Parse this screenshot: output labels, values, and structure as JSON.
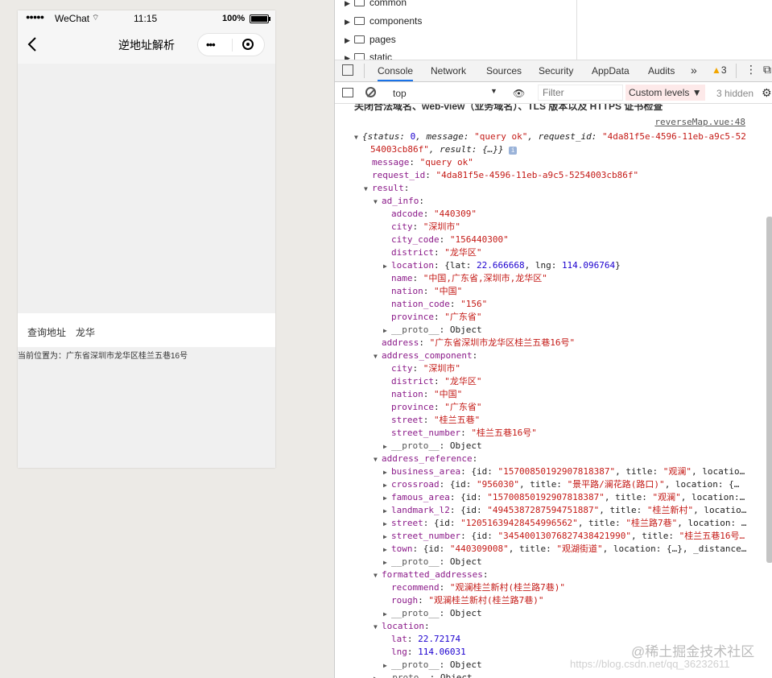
{
  "phone": {
    "status": {
      "signal": "●●●●●",
      "carrier": "WeChat",
      "wifi": "⌔",
      "time": "11:15",
      "battery": "100%"
    },
    "nav": {
      "title": "逆地址解析",
      "menu": "•••"
    },
    "query": {
      "label": "查询地址",
      "value": "龙华"
    },
    "current": "当前位置为：广东省深圳市龙华区桂兰五巷16号"
  },
  "devtools": {
    "tree": [
      {
        "label": "common"
      },
      {
        "label": "components"
      },
      {
        "label": "pages"
      },
      {
        "label": "static"
      }
    ],
    "tabs": [
      "Console",
      "Network",
      "Sources",
      "Security",
      "AppData",
      "Audits"
    ],
    "more": "»",
    "warnings": "3",
    "context": "top",
    "filter_placeholder": "Filter",
    "levels": "Custom levels ▼",
    "hidden": "3 hidden",
    "warning_text": "关闭合法域名、web-view（业务域名）、TLS 版本以及 HTTPS 证书检查",
    "source": "reverseMap.vue:48",
    "lines": [
      {
        "ind": 0,
        "tri": "▼",
        "html": "<span class='i'>{status: </span><span class='n'>0</span><span class='i'>, message: </span><span class='s'>\"query ok\"</span><span class='i'>, request_id: </span><span class='s'>\"4da81f5e-4596-11eb-a9c5-52</span>"
      },
      {
        "ind": 0,
        "tri": "",
        "html": "<span class='s'>54003cb86f\"</span><span class='i'>, result: {…}} </span><span class='info-badge'>i</span>"
      },
      {
        "ind": 1,
        "tri": "",
        "html": "<span class='k'>message</span><span class='p'>: </span><span class='s'>\"query ok\"</span>"
      },
      {
        "ind": 1,
        "tri": "",
        "html": "<span class='k'>request_id</span><span class='p'>: </span><span class='s'>\"4da81f5e-4596-11eb-a9c5-5254003cb86f\"</span>"
      },
      {
        "ind": 1,
        "tri": "▼",
        "html": "<span class='k'>result</span><span class='p'>:</span>"
      },
      {
        "ind": 2,
        "tri": "▼",
        "html": "<span class='k'>ad_info</span><span class='p'>:</span>"
      },
      {
        "ind": 3,
        "tri": "",
        "html": "<span class='k'>adcode</span><span class='p'>: </span><span class='s'>\"440309\"</span>"
      },
      {
        "ind": 3,
        "tri": "",
        "html": "<span class='k'>city</span><span class='p'>: </span><span class='s'>\"深圳市\"</span>"
      },
      {
        "ind": 3,
        "tri": "",
        "html": "<span class='k'>city_code</span><span class='p'>: </span><span class='s'>\"156440300\"</span>"
      },
      {
        "ind": 3,
        "tri": "",
        "html": "<span class='k'>district</span><span class='p'>: </span><span class='s'>\"龙华区\"</span>"
      },
      {
        "ind": 3,
        "tri": "▶",
        "html": "<span class='k'>location</span><span class='p'>: {lat: </span><span class='n'>22.666668</span><span class='p'>, lng: </span><span class='n'>114.096764</span><span class='p'>}</span>"
      },
      {
        "ind": 3,
        "tri": "",
        "html": "<span class='k'>name</span><span class='p'>: </span><span class='s'>\"中国,广东省,深圳市,龙华区\"</span>"
      },
      {
        "ind": 3,
        "tri": "",
        "html": "<span class='k'>nation</span><span class='p'>: </span><span class='s'>\"中国\"</span>"
      },
      {
        "ind": 3,
        "tri": "",
        "html": "<span class='k'>nation_code</span><span class='p'>: </span><span class='s'>\"156\"</span>"
      },
      {
        "ind": 3,
        "tri": "",
        "html": "<span class='k'>province</span><span class='p'>: </span><span class='s'>\"广东省\"</span>"
      },
      {
        "ind": 3,
        "tri": "▶",
        "html": "<span class='kp'>__proto__</span><span class='p'>: Object</span>"
      },
      {
        "ind": 2,
        "tri": "",
        "html": "<span class='k'>address</span><span class='p'>: </span><span class='s'>\"广东省深圳市龙华区桂兰五巷16号\"</span>"
      },
      {
        "ind": 2,
        "tri": "▼",
        "html": "<span class='k'>address_component</span><span class='p'>:</span>"
      },
      {
        "ind": 3,
        "tri": "",
        "html": "<span class='k'>city</span><span class='p'>: </span><span class='s'>\"深圳市\"</span>"
      },
      {
        "ind": 3,
        "tri": "",
        "html": "<span class='k'>district</span><span class='p'>: </span><span class='s'>\"龙华区\"</span>"
      },
      {
        "ind": 3,
        "tri": "",
        "html": "<span class='k'>nation</span><span class='p'>: </span><span class='s'>\"中国\"</span>"
      },
      {
        "ind": 3,
        "tri": "",
        "html": "<span class='k'>province</span><span class='p'>: </span><span class='s'>\"广东省\"</span>"
      },
      {
        "ind": 3,
        "tri": "",
        "html": "<span class='k'>street</span><span class='p'>: </span><span class='s'>\"桂兰五巷\"</span>"
      },
      {
        "ind": 3,
        "tri": "",
        "html": "<span class='k'>street_number</span><span class='p'>: </span><span class='s'>\"桂兰五巷16号\"</span>"
      },
      {
        "ind": 3,
        "tri": "▶",
        "html": "<span class='kp'>__proto__</span><span class='p'>: Object</span>"
      },
      {
        "ind": 2,
        "tri": "▼",
        "html": "<span class='k'>address_reference</span><span class='p'>:</span>"
      },
      {
        "ind": 3,
        "tri": "▶",
        "html": "<span class='k'>business_area</span><span class='p'>: {id: </span><span class='s'>\"15700850192907818387\"</span><span class='p'>, title: </span><span class='s'>\"观澜\"</span><span class='p'>, locatio…</span>"
      },
      {
        "ind": 3,
        "tri": "▶",
        "html": "<span class='k'>crossroad</span><span class='p'>: {id: </span><span class='s'>\"956030\"</span><span class='p'>, title: </span><span class='s'>\"景平路/澜花路(路口)\"</span><span class='p'>, location: {…</span>"
      },
      {
        "ind": 3,
        "tri": "▶",
        "html": "<span class='k'>famous_area</span><span class='p'>: {id: </span><span class='s'>\"15700850192907818387\"</span><span class='p'>, title: </span><span class='s'>\"观澜\"</span><span class='p'>, location:…</span>"
      },
      {
        "ind": 3,
        "tri": "▶",
        "html": "<span class='k'>landmark_l2</span><span class='p'>: {id: </span><span class='s'>\"4945387287594751887\"</span><span class='p'>, title: </span><span class='s'>\"桂兰新村\"</span><span class='p'>, locatio…</span>"
      },
      {
        "ind": 3,
        "tri": "▶",
        "html": "<span class='k'>street</span><span class='p'>: {id: </span><span class='s'>\"12051639428454996562\"</span><span class='p'>, title: </span><span class='s'>\"桂兰路7巷\"</span><span class='p'>, location: …</span>"
      },
      {
        "ind": 3,
        "tri": "▶",
        "html": "<span class='k'>street_number</span><span class='p'>: {id: </span><span class='s'>\"3454001307682743842199​0\"</span><span class='p'>, title: </span><span class='s'>\"桂兰五巷16号…</span>"
      },
      {
        "ind": 3,
        "tri": "▶",
        "html": "<span class='k'>town</span><span class='p'>: {id: </span><span class='s'>\"440309008\"</span><span class='p'>, title: </span><span class='s'>\"观湖街道\"</span><span class='p'>, location: {…}, _distance…</span>"
      },
      {
        "ind": 3,
        "tri": "▶",
        "html": "<span class='kp'>__proto__</span><span class='p'>: Object</span>"
      },
      {
        "ind": 2,
        "tri": "▼",
        "html": "<span class='k'>formatted_addresses</span><span class='p'>:</span>"
      },
      {
        "ind": 3,
        "tri": "",
        "html": "<span class='k'>recommend</span><span class='p'>: </span><span class='s'>\"观澜桂兰新村(桂兰路7巷)\"</span>"
      },
      {
        "ind": 3,
        "tri": "",
        "html": "<span class='k'>rough</span><span class='p'>: </span><span class='s'>\"观澜桂兰新村(桂兰路7巷)\"</span>"
      },
      {
        "ind": 3,
        "tri": "▶",
        "html": "<span class='kp'>__proto__</span><span class='p'>: Object</span>"
      },
      {
        "ind": 2,
        "tri": "▼",
        "html": "<span class='k'>location</span><span class='p'>:</span>"
      },
      {
        "ind": 3,
        "tri": "",
        "html": "<span class='k'>lat</span><span class='p'>: </span><span class='n'>22.72174</span>"
      },
      {
        "ind": 3,
        "tri": "",
        "html": "<span class='k'>lng</span><span class='p'>: </span><span class='n'>114.06031</span>"
      },
      {
        "ind": 3,
        "tri": "▶",
        "html": "<span class='kp'>__proto__</span><span class='p'>: Object</span>"
      },
      {
        "ind": 2,
        "tri": "▶",
        "html": "<span class='kp'>__proto__</span><span class='p'>: Object</span>"
      }
    ],
    "watermark": "@稀土掘金技术社区",
    "watermark2": "https://blog.csdn.net/qq_36232611"
  }
}
